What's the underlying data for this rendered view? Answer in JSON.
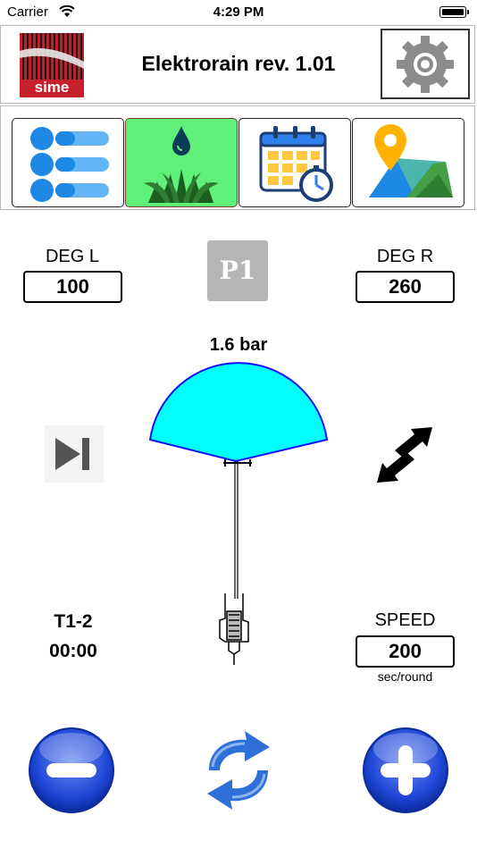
{
  "status_bar": {
    "carrier": "Carrier",
    "time": "4:29 PM"
  },
  "header": {
    "title": "Elektrorain rev. 1.01",
    "logo_text": "sime"
  },
  "nav": {
    "items": [
      {
        "id": "list",
        "active": false
      },
      {
        "id": "irrigation",
        "active": true
      },
      {
        "id": "schedule",
        "active": false
      },
      {
        "id": "map",
        "active": false
      }
    ]
  },
  "controls": {
    "deg_left": {
      "label": "DEG L",
      "value": "100"
    },
    "deg_right": {
      "label": "DEG R",
      "value": "260"
    },
    "program_badge": "P1",
    "pressure": "1.6 bar",
    "timer": {
      "label": "T1-2",
      "value": "00:00"
    },
    "speed": {
      "label": "SPEED",
      "value": "200",
      "unit": "sec/round"
    }
  },
  "colors": {
    "active_tab": "#5ff07a",
    "spray_fill": "#00ffff",
    "spray_stroke": "#1010ff",
    "round_button": "#1f47d8"
  }
}
